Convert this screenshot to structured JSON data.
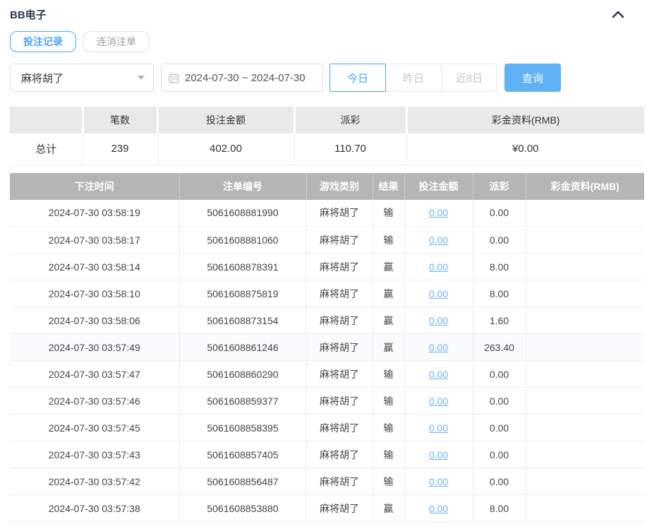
{
  "panel": {
    "title": "BB电子",
    "collapse_icon": "chevron-up"
  },
  "tabs": [
    {
      "label": "投注记录",
      "active": true
    },
    {
      "label": "连消注单",
      "active": false
    }
  ],
  "filters": {
    "game_select": {
      "value": "麻将胡了",
      "icon": "chevron-down-caret"
    },
    "date_range": {
      "value": "2024-07-30 ~ 2024-07-30",
      "icon": "calendar-icon"
    },
    "quick_buttons": [
      {
        "label": "今日",
        "active": true
      },
      {
        "label": "昨日",
        "active": false
      },
      {
        "label": "近8日",
        "active": false
      }
    ],
    "search_label": "查询"
  },
  "summary": {
    "headers": [
      "",
      "笔数",
      "投注金额",
      "派彩",
      "彩金资料(RMB)"
    ],
    "row": {
      "label": "总计",
      "count": "239",
      "bet_amount": "402.00",
      "payout": "110.70",
      "jackpot": "¥0.00"
    }
  },
  "table": {
    "headers": [
      "下注时间",
      "注单编号",
      "游戏类别",
      "结果",
      "投注金额",
      "派彩",
      "彩金资料(RMB)"
    ],
    "highlighted_row_index": 5,
    "rows": [
      {
        "time": "2024-07-30 03:58:19",
        "order_no": "5061608881990",
        "game": "麻将胡了",
        "result": "输",
        "bet_amount": "0.00",
        "payout": "0.00",
        "jackpot": ""
      },
      {
        "time": "2024-07-30 03:58:17",
        "order_no": "5061608881060",
        "game": "麻将胡了",
        "result": "输",
        "bet_amount": "0.00",
        "payout": "0.00",
        "jackpot": ""
      },
      {
        "time": "2024-07-30 03:58:14",
        "order_no": "5061608878391",
        "game": "麻将胡了",
        "result": "赢",
        "bet_amount": "0.00",
        "payout": "8.00",
        "jackpot": ""
      },
      {
        "time": "2024-07-30 03:58:10",
        "order_no": "5061608875819",
        "game": "麻将胡了",
        "result": "赢",
        "bet_amount": "0.00",
        "payout": "8.00",
        "jackpot": ""
      },
      {
        "time": "2024-07-30 03:58:06",
        "order_no": "5061608873154",
        "game": "麻将胡了",
        "result": "赢",
        "bet_amount": "0.00",
        "payout": "1.60",
        "jackpot": ""
      },
      {
        "time": "2024-07-30 03:57:49",
        "order_no": "5061608861246",
        "game": "麻将胡了",
        "result": "赢",
        "bet_amount": "0.00",
        "payout": "263.40",
        "jackpot": ""
      },
      {
        "time": "2024-07-30 03:57:47",
        "order_no": "5061608860290",
        "game": "麻将胡了",
        "result": "输",
        "bet_amount": "0.00",
        "payout": "0.00",
        "jackpot": ""
      },
      {
        "time": "2024-07-30 03:57:46",
        "order_no": "5061608859377",
        "game": "麻将胡了",
        "result": "输",
        "bet_amount": "0.00",
        "payout": "0.00",
        "jackpot": ""
      },
      {
        "time": "2024-07-30 03:57:45",
        "order_no": "5061608858395",
        "game": "麻将胡了",
        "result": "输",
        "bet_amount": "0.00",
        "payout": "0.00",
        "jackpot": ""
      },
      {
        "time": "2024-07-30 03:57:43",
        "order_no": "5061608857405",
        "game": "麻将胡了",
        "result": "输",
        "bet_amount": "0.00",
        "payout": "0.00",
        "jackpot": ""
      },
      {
        "time": "2024-07-30 03:57:42",
        "order_no": "5061608856487",
        "game": "麻将胡了",
        "result": "输",
        "bet_amount": "0.00",
        "payout": "0.00",
        "jackpot": ""
      },
      {
        "time": "2024-07-30 03:57:38",
        "order_no": "5061608853880",
        "game": "麻将胡了",
        "result": "赢",
        "bet_amount": "0.00",
        "payout": "8.00",
        "jackpot": ""
      }
    ]
  },
  "colors": {
    "accent_blue": "#4da3f5",
    "search_button_blue": "#5fb2f3",
    "link_blue": "#6cb3ef",
    "table_header_bg": "#b5b5b5",
    "summary_header_bg": "#e9e9e9",
    "title_color": "#2b3a4a"
  }
}
